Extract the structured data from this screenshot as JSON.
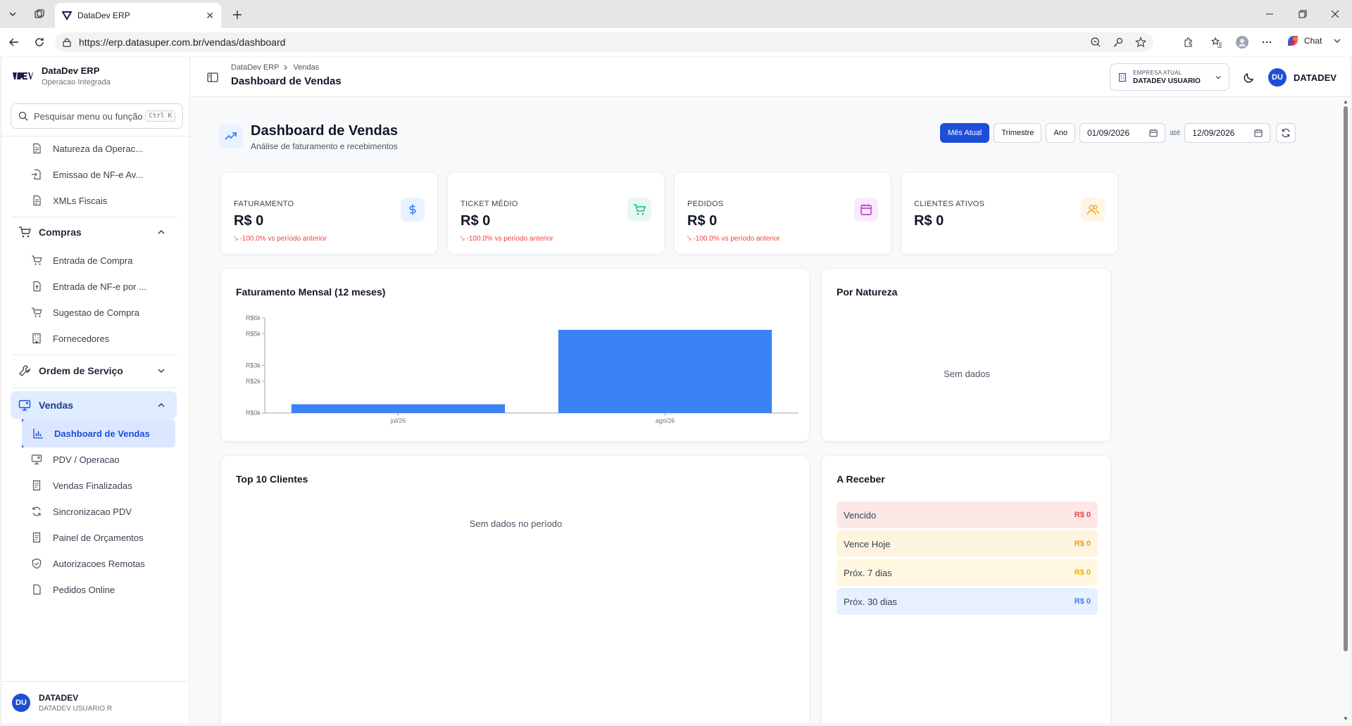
{
  "browser": {
    "tab_title": "DataDev ERP",
    "url": "https://erp.datasuper.com.br/vendas/dashboard",
    "chat_label": "Chat"
  },
  "sidebar": {
    "brand_title": "DataDev ERP",
    "brand_sub": "Operacao Integrada",
    "search_placeholder": "Pesquisar menu ou função",
    "search_kbd": "Ctrl K",
    "items_top": [
      {
        "label": "Natureza da Operac...",
        "icon": "document-icon"
      },
      {
        "label": "Emissao de NF-e Av...",
        "icon": "file-import-icon"
      },
      {
        "label": "XMLs Fiscais",
        "icon": "document-icon"
      }
    ],
    "group_compras": "Compras",
    "items_compras": [
      {
        "label": "Entrada de Compra",
        "icon": "cart-icon"
      },
      {
        "label": "Entrada de NF-e por ...",
        "icon": "file-upload-icon"
      },
      {
        "label": "Sugestao de Compra",
        "icon": "cart-icon"
      },
      {
        "label": "Fornecedores",
        "icon": "building-icon"
      }
    ],
    "group_os": "Ordem de Serviço",
    "group_vendas": "Vendas",
    "items_vendas": [
      {
        "label": "Dashboard de Vendas",
        "icon": "bar-chart-icon"
      },
      {
        "label": "PDV / Operacao",
        "icon": "monitor-icon"
      },
      {
        "label": "Vendas Finalizadas",
        "icon": "receipt-icon"
      },
      {
        "label": "Sincronizacao PDV",
        "icon": "sync-icon"
      },
      {
        "label": "Painel de Orçamentos",
        "icon": "receipt-icon"
      },
      {
        "label": "Autorizacoes Remotas",
        "icon": "shield-icon"
      },
      {
        "label": "Pedidos Online",
        "icon": "document-icon"
      }
    ],
    "user_initials": "DU",
    "user_name": "DATADEV",
    "user_sub": "DATADEV USUARIO R"
  },
  "header": {
    "crumb_root": "DataDev ERP",
    "crumb_current": "Vendas",
    "title": "Dashboard de Vendas",
    "company_label": "EMPRESA ATUAL",
    "company_value": "DATADEV USUARIO",
    "user_initials": "DU",
    "user_name": "DATADEV"
  },
  "page": {
    "title": "Dashboard de Vendas",
    "subtitle": "Análise de faturamento e recebimentos",
    "filters": {
      "month": "Mês Atual",
      "quarter": "Trimestre",
      "year": "Ano"
    },
    "date_from": "01/09/2026",
    "date_sep": "até",
    "date_to": "12/09/2026"
  },
  "kpis": [
    {
      "label": "FATURAMENTO",
      "value": "R$ 0",
      "delta": "-100.0% vs período anterior",
      "icon": "dollar-icon",
      "color": "#3b82f6",
      "bg": "#eaf2ff"
    },
    {
      "label": "TICKET MÉDIO",
      "value": "R$ 0",
      "delta": "-100.0% vs período anterior",
      "icon": "cart-icon",
      "color": "#10b981",
      "bg": "#e7f8f1"
    },
    {
      "label": "PEDIDOS",
      "value": "R$ 0",
      "delta": "-100.0% vs período anterior",
      "icon": "calendar-icon",
      "color": "#c026d3",
      "bg": "#f8ebfb"
    },
    {
      "label": "CLIENTES ATIVOS",
      "value": "R$ 0",
      "delta": "",
      "icon": "users-icon",
      "color": "#f59e0b",
      "bg": "#fff5e5"
    }
  ],
  "chart_data": {
    "type": "bar",
    "title": "Faturamento Mensal (12 meses)",
    "categories": [
      "jul/26",
      "ago/26"
    ],
    "values": [
      550,
      5250
    ],
    "ylim": [
      0,
      6000
    ],
    "yticks": [
      0,
      2000,
      3000,
      5000,
      6000
    ],
    "ytick_labels": [
      "R$0k",
      "R$2k",
      "R$3k",
      "R$5k",
      "R$6k"
    ],
    "bar_color": "#3b82f6",
    "grid": false
  },
  "natureza": {
    "title": "Por Natureza",
    "empty": "Sem dados"
  },
  "top_clientes": {
    "title": "Top 10 Clientes",
    "empty": "Sem dados no período"
  },
  "receber": {
    "title": "A Receber",
    "rows": [
      {
        "label": "Vencido",
        "amount": "R$ 0",
        "bg": "#fde8e8",
        "color": "#ef4444"
      },
      {
        "label": "Vence Hoje",
        "amount": "R$ 0",
        "bg": "#fff4e0",
        "color": "#f59e0b"
      },
      {
        "label": "Próx. 7 dias",
        "amount": "R$ 0",
        "bg": "#fff7e0",
        "color": "#eab308"
      },
      {
        "label": "Próx. 30 dias",
        "amount": "R$ 0",
        "bg": "#e7f0ff",
        "color": "#3b82f6"
      }
    ]
  }
}
